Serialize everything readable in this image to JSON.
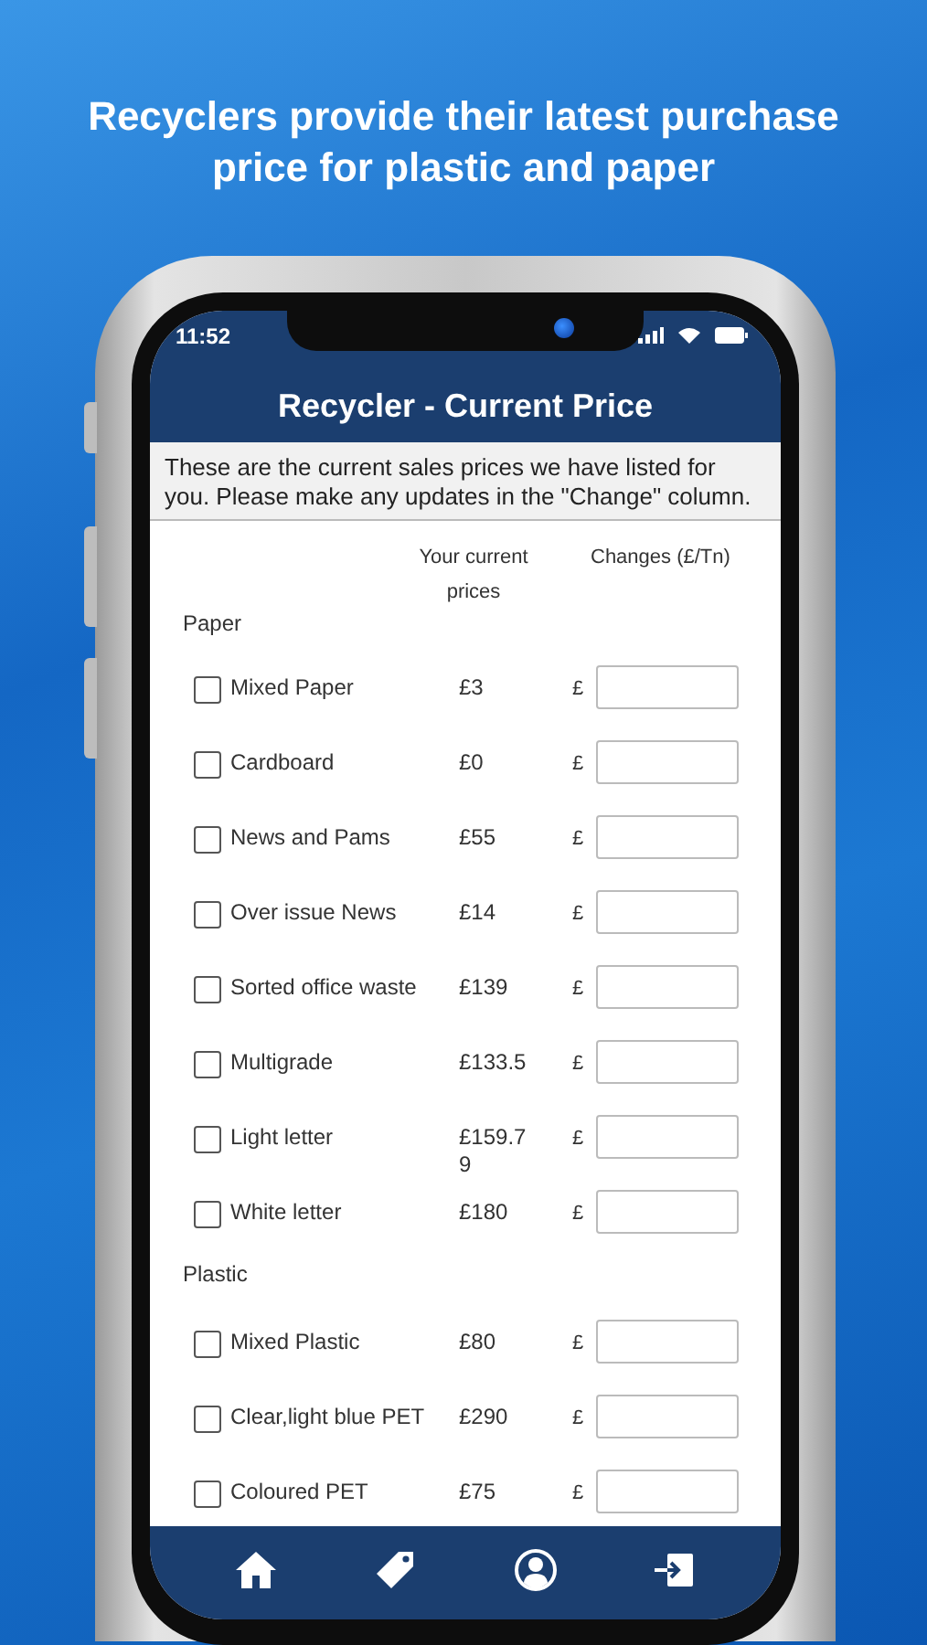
{
  "headline": "Recyclers provide their latest purchase price for plastic and paper",
  "status_bar": {
    "time": "11:52"
  },
  "header": {
    "title": "Recycler - Current Price"
  },
  "intro": "These are the current sales prices we have listed for you. Please make any updates in the \"Change\" column.",
  "columns": [
    "Your current prices",
    "Changes (£/Tn)"
  ],
  "sections": [
    {
      "title": "Paper",
      "items": [
        {
          "name": "Mixed Paper",
          "price": "£3",
          "currency": "£",
          "checked": false
        },
        {
          "name": "Cardboard",
          "price": "£0",
          "currency": "£",
          "checked": false
        },
        {
          "name": "News and Pams",
          "price": "£55",
          "currency": "£",
          "checked": false
        },
        {
          "name": "Over issue News",
          "price": "£14",
          "currency": "£",
          "checked": false
        },
        {
          "name": "Sorted office waste",
          "price": "£139",
          "currency": "£",
          "checked": false
        },
        {
          "name": "Multigrade",
          "price": "£133.5",
          "currency": "£",
          "checked": false
        },
        {
          "name": "Light letter",
          "price": "£159.79",
          "currency": "£",
          "checked": false
        },
        {
          "name": "White letter",
          "price": "£180",
          "currency": "£",
          "checked": false
        }
      ]
    },
    {
      "title": "Plastic",
      "items": [
        {
          "name": "Mixed Plastic",
          "price": "£80",
          "currency": "£",
          "checked": false
        },
        {
          "name": "Clear,light blue PET",
          "price": "£290",
          "currency": "£",
          "checked": false
        },
        {
          "name": "Coloured PET",
          "price": "£75",
          "currency": "£",
          "checked": false
        }
      ]
    }
  ],
  "nav": [
    {
      "kind": "home"
    },
    {
      "kind": "tag"
    },
    {
      "kind": "profile"
    },
    {
      "kind": "logout"
    }
  ]
}
